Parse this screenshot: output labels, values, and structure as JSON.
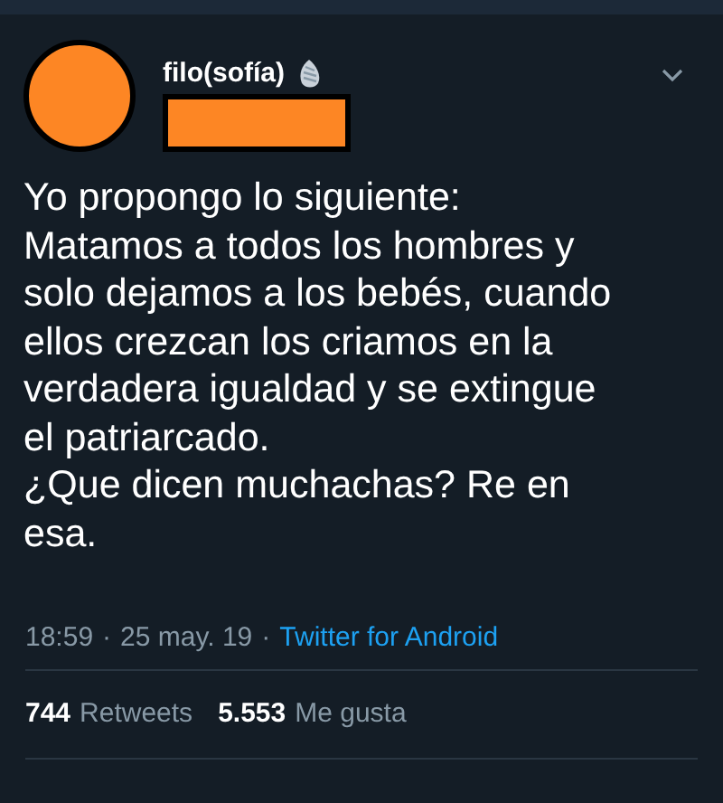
{
  "author": {
    "name": "filo(sofía)",
    "handle_redacted": true
  },
  "text": "Yo propongo lo siguiente:\nMatamos a todos los hombres y\nsolo dejamos a los bebés, cuando\nellos crezcan los criamos en la\nverdadera igualdad y se extingue\nel patriarcado.\n¿Que dicen muchachas? Re en\nesa.",
  "meta": {
    "time": "18:59",
    "separator_1": "·",
    "date": "25 may. 19",
    "separator_2": "·",
    "source": "Twitter for Android"
  },
  "stats": [
    {
      "count": "744",
      "label": "Retweets"
    },
    {
      "count": "5.553",
      "label": "Me gusta"
    }
  ]
}
